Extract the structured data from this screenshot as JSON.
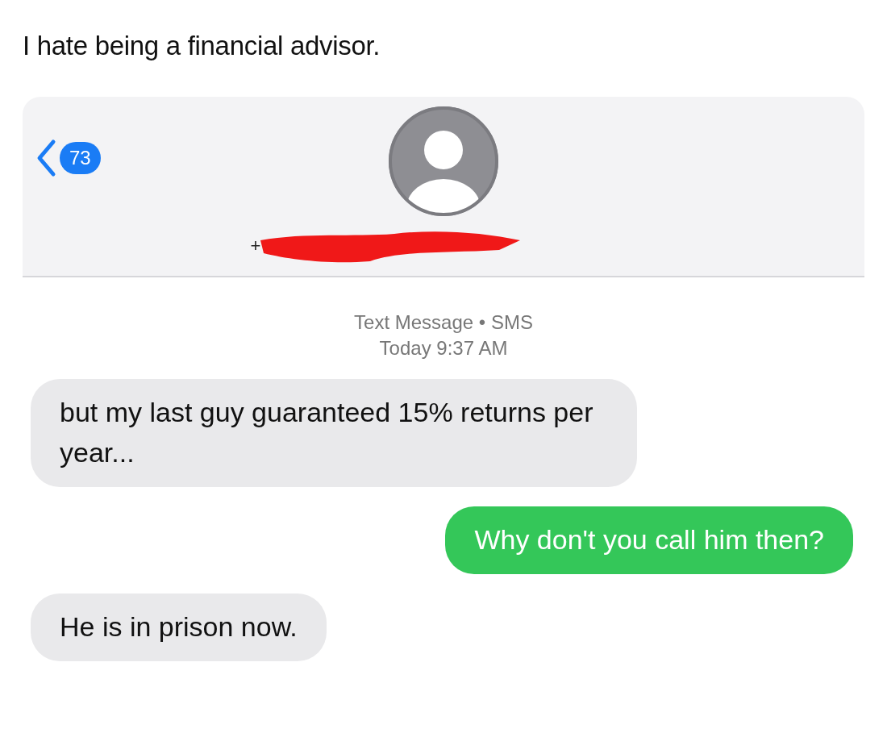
{
  "post": {
    "text": "I hate being a financial advisor."
  },
  "conversation": {
    "back_badge": "73",
    "contact_number": "+",
    "service": "Text Message • SMS",
    "timestamp": "Today 9:37 AM"
  },
  "messages": [
    {
      "kind": "incoming",
      "text": "but my last guy guaranteed 15% returns per year..."
    },
    {
      "kind": "outgoing",
      "text": "Why don't you call him then?"
    },
    {
      "kind": "incoming",
      "text": "He is in prison now."
    }
  ]
}
